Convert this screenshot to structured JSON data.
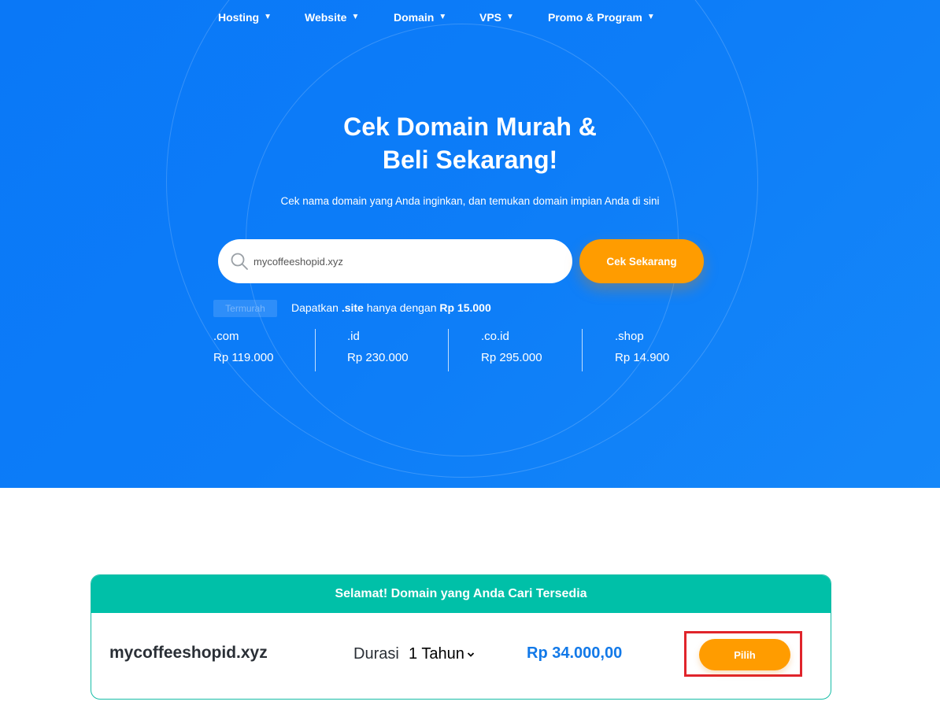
{
  "nav": {
    "items": [
      {
        "label": "Hosting"
      },
      {
        "label": "Website"
      },
      {
        "label": "Domain"
      },
      {
        "label": "VPS"
      },
      {
        "label": "Promo & Program"
      }
    ],
    "caret": "▼"
  },
  "hero": {
    "title_line1": "Cek Domain Murah &",
    "title_line2": "Beli Sekarang!",
    "subtitle": "Cek nama domain yang Anda inginkan, dan temukan domain impian Anda di sini"
  },
  "search": {
    "value": "mycoffeeshopid.xyz",
    "button_label": "Cek Sekarang"
  },
  "promo": {
    "badge": "Termurah",
    "text_prefix": "Dapatkan ",
    "tld": ".site",
    "text_mid": " hanya dengan ",
    "price": "Rp 15.000"
  },
  "tlds": [
    {
      "name": ".com",
      "price": "Rp 119.000"
    },
    {
      "name": ".id",
      "price": "Rp 230.000"
    },
    {
      "name": ".co.id",
      "price": "Rp 295.000"
    },
    {
      "name": ".shop",
      "price": "Rp 14.900"
    }
  ],
  "result": {
    "header": "Selamat! Domain yang Anda Cari Tersedia",
    "domain": "mycoffeeshopid.xyz",
    "duration_label": "Durasi",
    "duration_value": "1 Tahun",
    "price": "Rp 34.000,00",
    "button_label": "Pilih"
  },
  "colors": {
    "hero_blue": "#0d7df8",
    "accent_orange": "#ff9c00",
    "success_teal": "#00c0a8",
    "price_blue": "#1279e8",
    "highlight_red": "#e0242b"
  }
}
